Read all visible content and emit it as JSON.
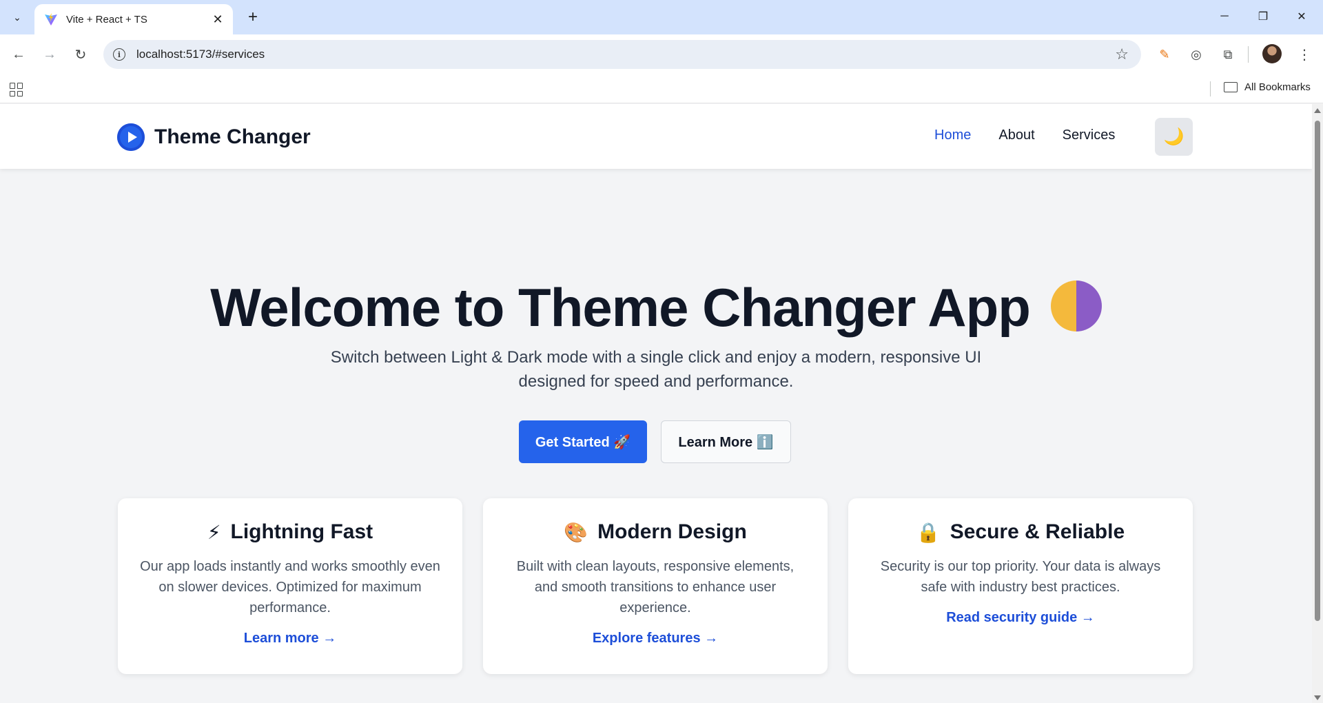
{
  "browser": {
    "tab_title": "Vite + React + TS",
    "url": "localhost:5173/#services",
    "bookmarks_label": "All Bookmarks",
    "icons": [
      "tab-search-icon",
      "vite-favicon",
      "close-icon",
      "plus-icon",
      "minimize-icon",
      "restore-icon",
      "close-window-icon",
      "back-icon",
      "forward-icon",
      "reload-icon",
      "site-info-icon",
      "star-icon",
      "eyedropper-icon",
      "extension-icon",
      "puzzle-icon",
      "profile-avatar",
      "kebab-menu-icon",
      "apps-icon",
      "folder-icon"
    ]
  },
  "header": {
    "brand": "Theme Changer",
    "nav": [
      "Home",
      "About",
      "Services"
    ],
    "active_nav": "Home",
    "theme_toggle_icon": "🌙"
  },
  "hero": {
    "title": "Welcome to Theme Changer App",
    "subtitle": "Switch between Light & Dark mode with a single click and enjoy a modern, responsive UI designed for speed and performance.",
    "primary_button": "Get Started 🚀",
    "secondary_button": "Learn More ℹ️"
  },
  "cards": [
    {
      "icon": "⚡",
      "title": "Lightning Fast",
      "text": "Our app loads instantly and works smoothly even on slower devices. Optimized for maximum performance.",
      "link": "Learn more →"
    },
    {
      "icon": "🎨",
      "title": "Modern Design",
      "text": "Built with clean layouts, responsive elements, and smooth transitions to enhance user experience.",
      "link": "Explore features →"
    },
    {
      "icon": "🔒",
      "title": "Secure & Reliable",
      "text": "Security is our top priority. Your data is always safe with industry best practices.",
      "link": "Read security guide →"
    }
  ],
  "colors": {
    "accent": "#2563eb",
    "link": "#1d4ed8",
    "page_bg": "#f3f4f6",
    "heading": "#111827"
  }
}
